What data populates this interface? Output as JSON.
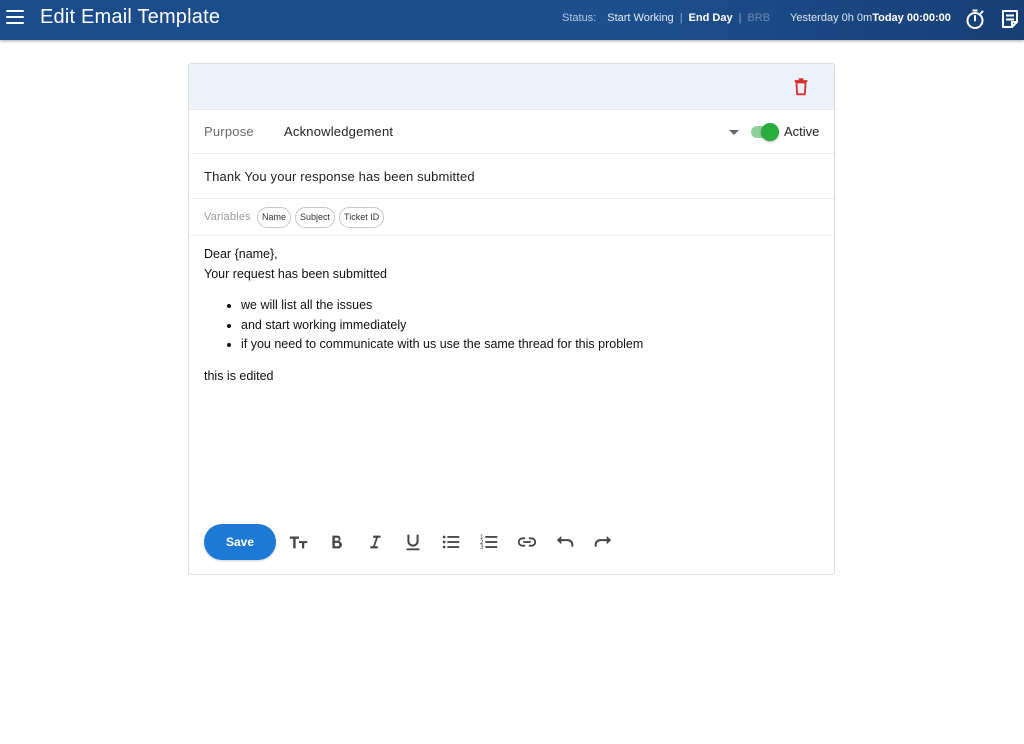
{
  "header": {
    "title": "Edit Email Template",
    "status_label": "Status:",
    "status_start": "Start Working",
    "status_end": "End Day",
    "status_brb": "BRB",
    "separator": "|",
    "time_yesterday": "Yesterday 0h 0m",
    "time_today": "Today 00:00:00",
    "icons": [
      "menu-icon",
      "stopwatch-icon",
      "notes-icon"
    ]
  },
  "form": {
    "purpose_label": "Purpose",
    "purpose_value": "Acknowledgement",
    "active_label": "Active",
    "active_on": true,
    "subject_value": "Thank You your response has been submitted",
    "variables_label": "Variables",
    "variables": [
      "Name",
      "Subject",
      "Ticket ID"
    ]
  },
  "editor": {
    "greeting": "Dear {name},",
    "line1": "Your request has been submitted",
    "bullets": [
      "we will list all the issues",
      "and start working immediately",
      "if you need to communicate with us use the same thread for this problem"
    ],
    "footer_line": "this is edited"
  },
  "toolbar": {
    "save_label": "Save",
    "tools": [
      "text-size-icon",
      "bold-icon",
      "italic-icon",
      "underline-icon",
      "bullet-list-icon",
      "numbered-list-icon",
      "link-icon",
      "undo-icon",
      "redo-icon"
    ]
  },
  "colors": {
    "header_bg": "#1d4f8f",
    "primary": "#1c7ad6",
    "toggle_on": "#27ae3f",
    "delete": "#d32f2f"
  }
}
